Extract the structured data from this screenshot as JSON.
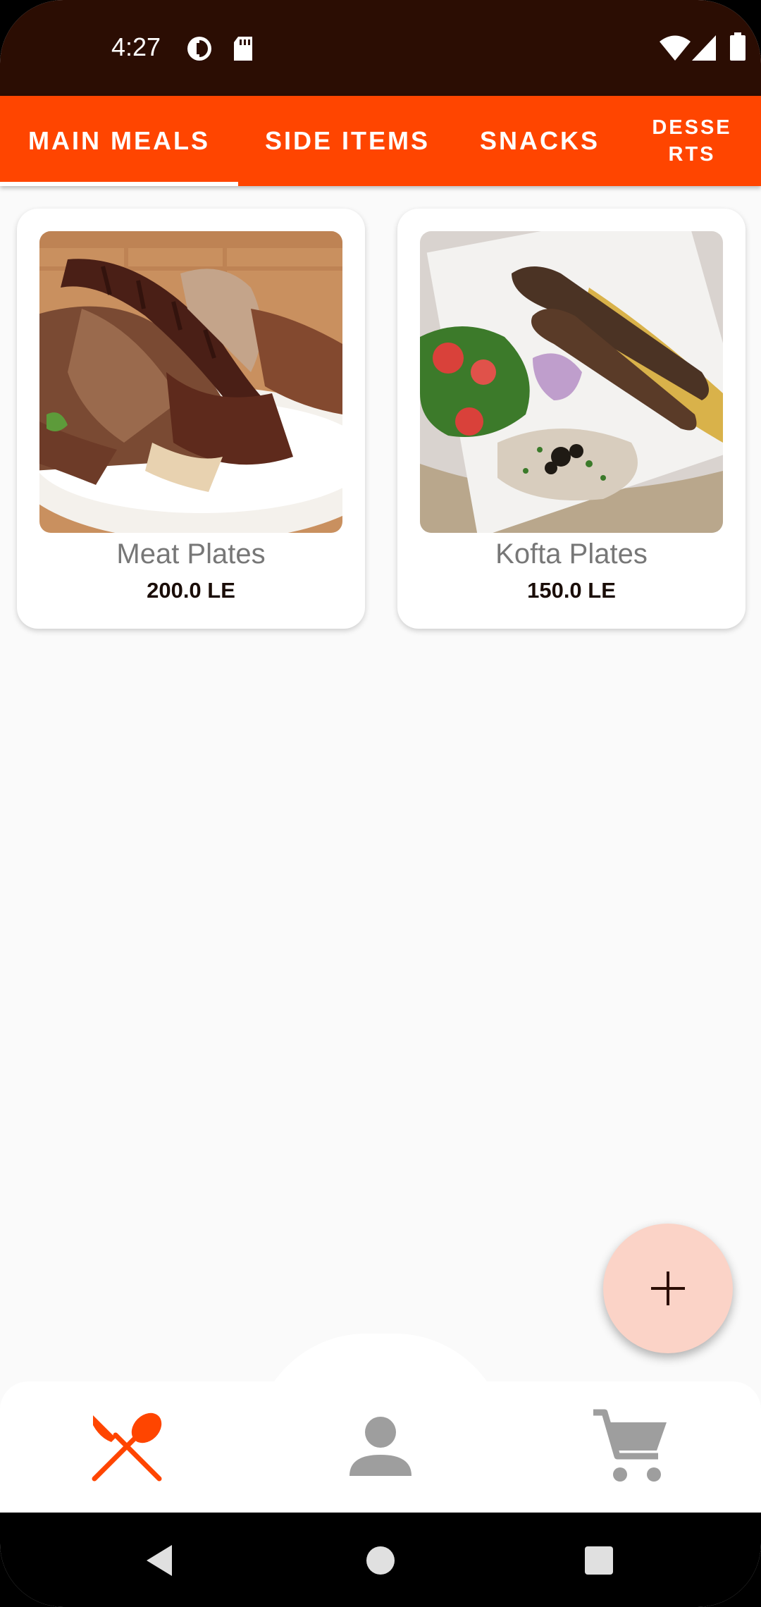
{
  "status_bar": {
    "time": "4:27",
    "icons": [
      "data-saver-icon",
      "sd-card-icon",
      "wifi-icon",
      "signal-icon",
      "battery-icon"
    ]
  },
  "tabs": [
    {
      "label": "MAIN MEALS",
      "selected": true
    },
    {
      "label": "SIDE ITEMS",
      "selected": false
    },
    {
      "label": "SNACKS",
      "selected": false
    },
    {
      "label": "DESSE\nRTS",
      "line1": "DESSE",
      "line2": "RTS",
      "selected": false
    }
  ],
  "products": [
    {
      "name": "Meat Plates",
      "price": "200.0 LE",
      "image": "grilled-meat-plate-photo"
    },
    {
      "name": "Kofta Plates",
      "price": "150.0 LE",
      "image": "kofta-plate-photo"
    }
  ],
  "fab": {
    "icon": "plus-icon"
  },
  "bottom_nav": [
    {
      "icon": "restaurant-icon",
      "active": true
    },
    {
      "icon": "person-icon",
      "active": false
    },
    {
      "icon": "cart-icon",
      "active": false
    }
  ],
  "colors": {
    "primary": "#ff4500",
    "status_bar": "#2b0d03",
    "fab": "#fbd3c7",
    "inactive_icon": "#9e9e9e"
  }
}
